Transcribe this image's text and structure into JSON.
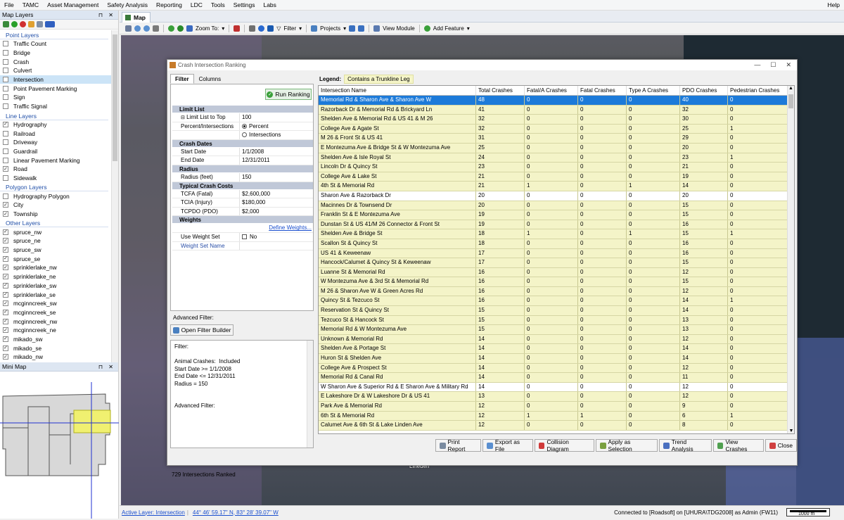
{
  "menu": [
    "File",
    "TAMC",
    "Asset Management",
    "Safety Analysis",
    "Reporting",
    "LDC",
    "Tools",
    "Settings",
    "Labs"
  ],
  "menu_help": "Help",
  "map_layers": {
    "title": "Map Layers",
    "groups": [
      {
        "name": "Point Layers",
        "items": [
          {
            "label": "Traffic Count",
            "checked": false
          },
          {
            "label": "Bridge",
            "checked": false
          },
          {
            "label": "Crash",
            "checked": false
          },
          {
            "label": "Culvert",
            "checked": false
          },
          {
            "label": "Intersection",
            "checked": false,
            "selected": true
          },
          {
            "label": "Point Pavement Marking",
            "checked": false
          },
          {
            "label": "Sign",
            "checked": false
          },
          {
            "label": "Traffic Signal",
            "checked": false
          }
        ]
      },
      {
        "name": "Line Layers",
        "items": [
          {
            "label": "Hydrography",
            "checked": true
          },
          {
            "label": "Railroad",
            "checked": false
          },
          {
            "label": "Driveway",
            "checked": false
          },
          {
            "label": "Guardrail",
            "checked": false
          },
          {
            "label": "Linear Pavement Marking",
            "checked": false
          },
          {
            "label": "Road",
            "checked": true
          },
          {
            "label": "Sidewalk",
            "checked": false
          }
        ]
      },
      {
        "name": "Polygon Layers",
        "items": [
          {
            "label": "Hydrography Polygon",
            "checked": false
          },
          {
            "label": "City",
            "checked": true
          },
          {
            "label": "Township",
            "checked": true
          }
        ]
      },
      {
        "name": "Other Layers",
        "items": [
          {
            "label": "spruce_nw",
            "checked": true
          },
          {
            "label": "spruce_ne",
            "checked": true
          },
          {
            "label": "spruce_sw",
            "checked": true
          },
          {
            "label": "spruce_se",
            "checked": true
          },
          {
            "label": "sprinklerlake_nw",
            "checked": true
          },
          {
            "label": "sprinklerlake_ne",
            "checked": true
          },
          {
            "label": "sprinklerlake_sw",
            "checked": true
          },
          {
            "label": "sprinklerlake_se",
            "checked": true
          },
          {
            "label": "mcginncreek_sw",
            "checked": true
          },
          {
            "label": "mcginncreek_se",
            "checked": true
          },
          {
            "label": "mcginncreek_nw",
            "checked": true
          },
          {
            "label": "mcginncreek_ne",
            "checked": true
          },
          {
            "label": "mikado_sw",
            "checked": true
          },
          {
            "label": "mikado_se",
            "checked": true
          },
          {
            "label": "mikado_nw",
            "checked": true
          }
        ]
      }
    ]
  },
  "mini_map": {
    "title": "Mini Map"
  },
  "map": {
    "tab": "Map",
    "toolbar": {
      "zoom_to": "Zoom To:",
      "filter": "Filter",
      "projects": "Projects",
      "view_module": "View Module",
      "add_feature": "Add Feature"
    },
    "place_label": "Lineden"
  },
  "status": {
    "active_layer": "Active Layer: Intersection",
    "coords": "44° 46' 59.17\" N, 83° 28' 39.07\" W",
    "connection": "Connected to [Roadsoft] on [UHURA\\TDG2008] as Admin (FW11)",
    "scale": "1000 m"
  },
  "dialog": {
    "title": "Crash Intersection Ranking",
    "tabs": [
      "Filter",
      "Columns"
    ],
    "run_button": "Run Ranking",
    "sections": {
      "limit": {
        "header": "Limit List",
        "limit_label": "Limit List to Top",
        "limit_value": "100",
        "pi_label": "Percent/Intersections",
        "opt_percent": "Percent",
        "opt_intersections": "Intersections"
      },
      "dates": {
        "header": "Crash Dates",
        "start_label": "Start Date",
        "start_value": "1/1/2008",
        "end_label": "End Date",
        "end_value": "12/31/2011"
      },
      "radius": {
        "header": "Radius",
        "label": "Radius (feet)",
        "value": "150"
      },
      "costs": {
        "header": "Typical Crash Costs",
        "fatal_label": "TCFA (Fatal)",
        "fatal_value": "$2,600,000",
        "injury_label": "TCIA (Injury)",
        "injury_value": "$180,000",
        "pdo_label": "TCPDO (PDO)",
        "pdo_value": "$2,000"
      },
      "weights": {
        "header": "Weights",
        "define": "Define Weights...",
        "use_label": "Use Weight Set",
        "use_value": "No",
        "set_name_label": "Weight Set Name"
      }
    },
    "advanced_filter_label": "Advanced Filter:",
    "open_filter_builder": "Open Filter Builder",
    "filter_summary": [
      "Filter:",
      "",
      "Animal Crashes:  Included",
      "Start Date >= 1/1/2008",
      "End Date <= 12/31/2011",
      "Radius = 150",
      "",
      "",
      "Advanced Filter:"
    ],
    "ranked_count": "729 Intersections Ranked",
    "legend_label": "Legend:",
    "legend_item": "Contains a Trunkline Leg",
    "columns": [
      "Intersection Name",
      "Total Crashes",
      "Fatal/A Crashes",
      "Fatal Crashes",
      "Type A Crashes",
      "PDO Crashes",
      "Pedestrian Crashes"
    ],
    "rows": [
      {
        "cells": [
          "Memorial Rd & Sharon Ave & Sharon Ave W",
          "48",
          "0",
          "0",
          "0",
          "40",
          "0"
        ],
        "style": "s"
      },
      {
        "cells": [
          "Razorback Dr & Memorial Rd & Brickyard Ln",
          "41",
          "0",
          "0",
          "0",
          "32",
          "0"
        ],
        "style": "y"
      },
      {
        "cells": [
          "Shelden Ave & Memorial Rd & US 41 & M 26",
          "32",
          "0",
          "0",
          "0",
          "30",
          "0"
        ],
        "style": "y"
      },
      {
        "cells": [
          "College Ave & Agate St",
          "32",
          "0",
          "0",
          "0",
          "25",
          "1"
        ],
        "style": "y"
      },
      {
        "cells": [
          "M 26 & Front St & US 41",
          "31",
          "0",
          "0",
          "0",
          "29",
          "0"
        ],
        "style": "y"
      },
      {
        "cells": [
          "E Montezuma Ave & Bridge St & W Montezuma Ave",
          "25",
          "0",
          "0",
          "0",
          "20",
          "0"
        ],
        "style": "y"
      },
      {
        "cells": [
          "Shelden Ave & Isle Royal St",
          "24",
          "0",
          "0",
          "0",
          "23",
          "1"
        ],
        "style": "y"
      },
      {
        "cells": [
          "Lincoln Dr & Quincy St",
          "23",
          "0",
          "0",
          "0",
          "21",
          "0"
        ],
        "style": "y"
      },
      {
        "cells": [
          "College Ave & Lake St",
          "21",
          "0",
          "0",
          "0",
          "19",
          "0"
        ],
        "style": "y"
      },
      {
        "cells": [
          "4th St & Memorial Rd",
          "21",
          "1",
          "0",
          "1",
          "14",
          "0"
        ],
        "style": "y"
      },
      {
        "cells": [
          "Sharon Ave & Razorback Dr",
          "20",
          "0",
          "0",
          "0",
          "20",
          "0"
        ],
        "style": "w"
      },
      {
        "cells": [
          "Macinnes Dr & Townsend Dr",
          "20",
          "0",
          "0",
          "0",
          "15",
          "0"
        ],
        "style": "y"
      },
      {
        "cells": [
          "Franklin St & E Montezuma Ave",
          "19",
          "0",
          "0",
          "0",
          "15",
          "0"
        ],
        "style": "y"
      },
      {
        "cells": [
          "Dunstan St & US 41/M 26 Connector & Front St",
          "19",
          "0",
          "0",
          "0",
          "16",
          "0"
        ],
        "style": "y"
      },
      {
        "cells": [
          "Shelden Ave & Bridge St",
          "18",
          "1",
          "0",
          "1",
          "15",
          "1"
        ],
        "style": "y"
      },
      {
        "cells": [
          "Scallon St & Quincy St",
          "18",
          "0",
          "0",
          "0",
          "16",
          "0"
        ],
        "style": "y"
      },
      {
        "cells": [
          "US 41 & Keweenaw",
          "17",
          "0",
          "0",
          "0",
          "16",
          "0"
        ],
        "style": "y"
      },
      {
        "cells": [
          "Hancock/Calumet & Quincy St & Keweenaw",
          "17",
          "0",
          "0",
          "0",
          "15",
          "0"
        ],
        "style": "y"
      },
      {
        "cells": [
          "Luanne St & Memorial Rd",
          "16",
          "0",
          "0",
          "0",
          "12",
          "0"
        ],
        "style": "y"
      },
      {
        "cells": [
          "W Montezuma Ave & 3rd St & Memorial Rd",
          "16",
          "0",
          "0",
          "0",
          "15",
          "0"
        ],
        "style": "y"
      },
      {
        "cells": [
          "M 26 & Sharon Ave W & Green Acres Rd",
          "16",
          "0",
          "0",
          "0",
          "12",
          "0"
        ],
        "style": "y"
      },
      {
        "cells": [
          "Quincy St & Tezcuco St",
          "16",
          "0",
          "0",
          "0",
          "14",
          "1"
        ],
        "style": "y"
      },
      {
        "cells": [
          "Reservation St & Quincy St",
          "15",
          "0",
          "0",
          "0",
          "14",
          "0"
        ],
        "style": "y"
      },
      {
        "cells": [
          "Tezcuco St & Hancock St",
          "15",
          "0",
          "0",
          "0",
          "13",
          "0"
        ],
        "style": "y"
      },
      {
        "cells": [
          "Memorial Rd & W Montezuma Ave",
          "15",
          "0",
          "0",
          "0",
          "13",
          "0"
        ],
        "style": "y"
      },
      {
        "cells": [
          "Unknown & Memorial Rd",
          "14",
          "0",
          "0",
          "0",
          "12",
          "0"
        ],
        "style": "y"
      },
      {
        "cells": [
          "Shelden Ave & Portage St",
          "14",
          "0",
          "0",
          "0",
          "14",
          "0"
        ],
        "style": "y"
      },
      {
        "cells": [
          "Huron St & Shelden Ave",
          "14",
          "0",
          "0",
          "0",
          "14",
          "0"
        ],
        "style": "y"
      },
      {
        "cells": [
          "College Ave & Prospect St",
          "14",
          "0",
          "0",
          "0",
          "12",
          "0"
        ],
        "style": "y"
      },
      {
        "cells": [
          "Memorial Rd & Canal Rd",
          "14",
          "0",
          "0",
          "0",
          "11",
          "0"
        ],
        "style": "y"
      },
      {
        "cells": [
          "W Sharon Ave & Superior Rd & E Sharon Ave & Military Rd",
          "14",
          "0",
          "0",
          "0",
          "12",
          "0"
        ],
        "style": "w"
      },
      {
        "cells": [
          "E Lakeshore Dr & W Lakeshore Dr & US 41",
          "13",
          "0",
          "0",
          "0",
          "12",
          "0"
        ],
        "style": "y"
      },
      {
        "cells": [
          "Park Ave & Memorial Rd",
          "12",
          "0",
          "0",
          "0",
          "9",
          "0"
        ],
        "style": "y"
      },
      {
        "cells": [
          "6th St & Memorial Rd",
          "12",
          "1",
          "1",
          "0",
          "6",
          "1"
        ],
        "style": "y"
      },
      {
        "cells": [
          "Calumet Ave & 6th St & Lake Linden Ave",
          "12",
          "0",
          "0",
          "0",
          "8",
          "0"
        ],
        "style": "y"
      }
    ],
    "buttons": [
      {
        "label": "Print Report",
        "icon": "printer-icon",
        "color": "#7a8ba0"
      },
      {
        "label": "Export as File",
        "icon": "export-icon",
        "color": "#5a8fd0"
      },
      {
        "label": "Collision Diagram",
        "icon": "collision-icon",
        "color": "#d03a3a"
      },
      {
        "label": "Apply as Selection",
        "icon": "apply-icon",
        "color": "#7aa040"
      },
      {
        "label": "Trend Analysis",
        "icon": "chart-icon",
        "color": "#4a70c0"
      },
      {
        "label": "View Crashes",
        "icon": "check-icon",
        "color": "#50a050"
      },
      {
        "label": "Close",
        "icon": "close-icon",
        "color": "#d04040"
      }
    ]
  },
  "colors": {
    "selection": "#1c7ad9",
    "trunkline": "#f4f4c8",
    "panel_header": "#dde6f2"
  }
}
